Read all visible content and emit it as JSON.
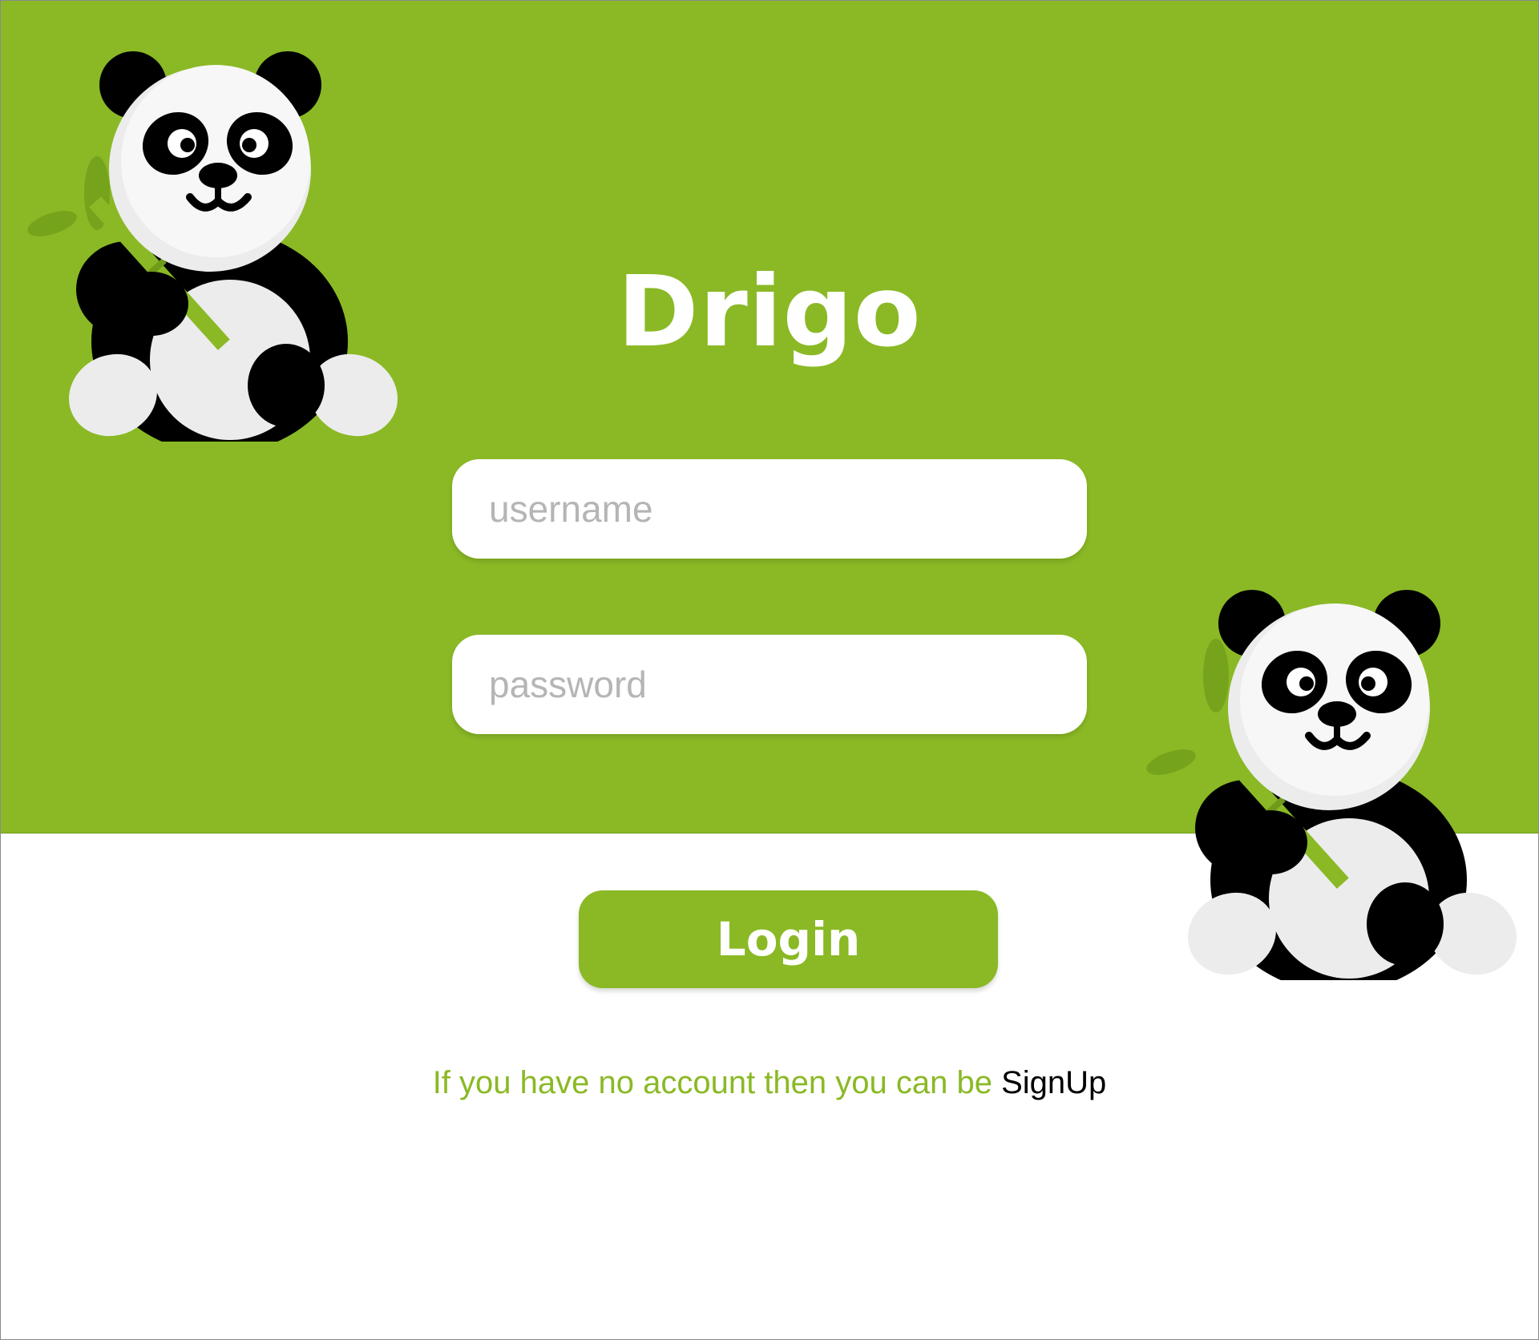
{
  "app": {
    "title": "Drigo"
  },
  "form": {
    "username_placeholder": "username",
    "password_placeholder": "password",
    "login_label": "Login"
  },
  "signup": {
    "prompt": "If you have no account then you can be ",
    "link_label": "SignUp"
  },
  "illustrations": {
    "left": "panda-with-bamboo-icon",
    "right": "panda-with-bamboo-icon"
  },
  "colors": {
    "brand_green": "#8ab925",
    "white": "#ffffff",
    "placeholder_gray": "#b5b5b5",
    "link_black": "#000000"
  }
}
